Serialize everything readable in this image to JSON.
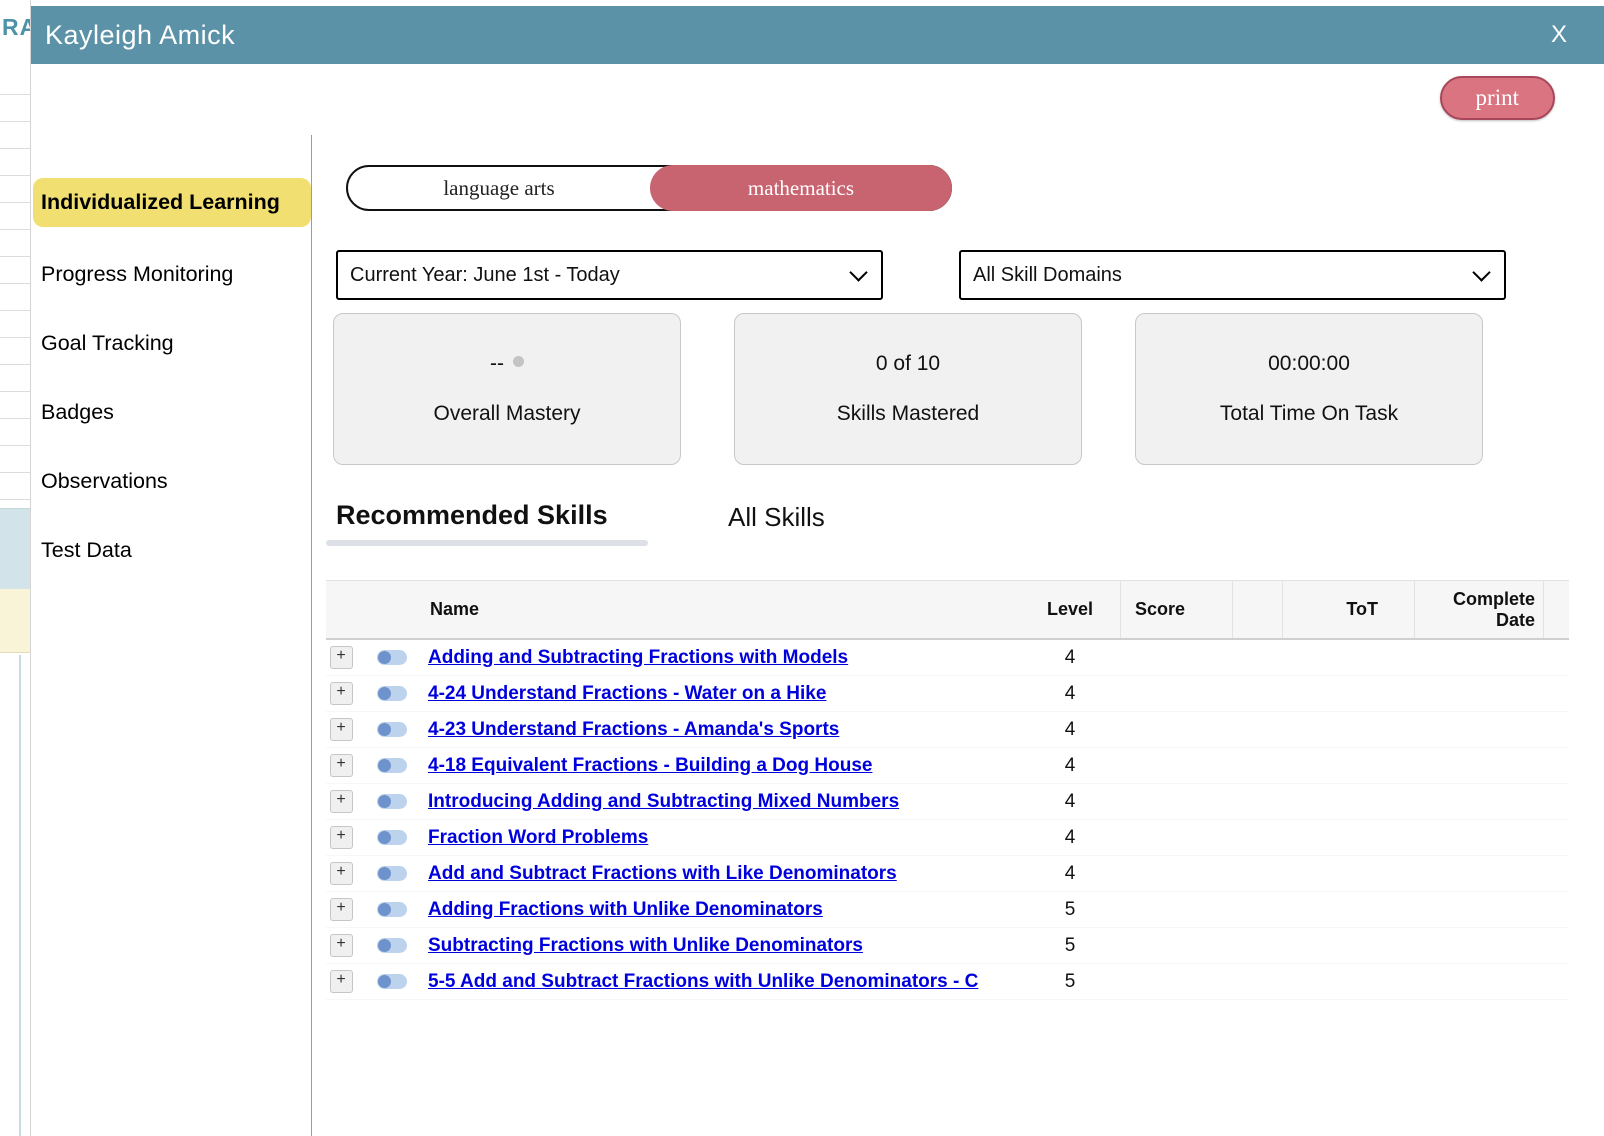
{
  "overlay": {
    "title": "Kayleigh Amick",
    "close_label": "X",
    "print_label": "print"
  },
  "background_page": {
    "clipped_text": "RA"
  },
  "sidebar": {
    "items": [
      {
        "label": "Individualized Learning",
        "active": true
      },
      {
        "label": "Progress Monitoring",
        "active": false
      },
      {
        "label": "Goal Tracking",
        "active": false
      },
      {
        "label": "Badges",
        "active": false
      },
      {
        "label": "Observations",
        "active": false
      },
      {
        "label": "Test Data",
        "active": false
      }
    ]
  },
  "subject_toggle": {
    "options": [
      {
        "label": "language arts",
        "selected": false
      },
      {
        "label": "mathematics",
        "selected": true
      }
    ]
  },
  "filters": {
    "date_range": "Current Year: June 1st - Today",
    "skill_domain": "All Skill Domains"
  },
  "stats": [
    {
      "value": "--",
      "label": "Overall Mastery",
      "has_dot": true
    },
    {
      "value": "0 of 10",
      "label": "Skills Mastered",
      "has_dot": false
    },
    {
      "value": "00:00:00",
      "label": "Total Time On Task",
      "has_dot": false
    }
  ],
  "tabs": {
    "recommended_label": "Recommended Skills",
    "all_label": "All Skills"
  },
  "table": {
    "headers": {
      "name": "Name",
      "level": "Level",
      "score": "Score",
      "tot": "ToT",
      "complete_date": "Complete Date"
    },
    "rows": [
      {
        "name": "Adding and Subtracting Fractions with Models",
        "level": "4",
        "score": "",
        "tot": "",
        "complete_date": ""
      },
      {
        "name": "4-24 Understand Fractions - Water on a Hike",
        "level": "4",
        "score": "",
        "tot": "",
        "complete_date": ""
      },
      {
        "name": "4-23 Understand Fractions - Amanda's Sports",
        "level": "4",
        "score": "",
        "tot": "",
        "complete_date": ""
      },
      {
        "name": "4-18 Equivalent Fractions - Building a Dog House",
        "level": "4",
        "score": "",
        "tot": "",
        "complete_date": ""
      },
      {
        "name": "Introducing Adding and Subtracting Mixed Numbers",
        "level": "4",
        "score": "",
        "tot": "",
        "complete_date": ""
      },
      {
        "name": "Fraction Word Problems",
        "level": "4",
        "score": "",
        "tot": "",
        "complete_date": ""
      },
      {
        "name": "Add and Subtract Fractions with Like Denominators",
        "level": "4",
        "score": "",
        "tot": "",
        "complete_date": ""
      },
      {
        "name": "Adding Fractions with Unlike Denominators",
        "level": "5",
        "score": "",
        "tot": "",
        "complete_date": ""
      },
      {
        "name": "Subtracting Fractions with Unlike Denominators",
        "level": "5",
        "score": "",
        "tot": "",
        "complete_date": ""
      },
      {
        "name": "5-5 Add and Subtract Fractions with Unlike Denominators - C",
        "level": "5",
        "score": "",
        "tot": "",
        "complete_date": ""
      }
    ]
  },
  "colors": {
    "header_teal": "#5b92a8",
    "accent_red": "#c86370",
    "highlight_yellow": "#f1e071",
    "link_blue": "#0000dd"
  }
}
